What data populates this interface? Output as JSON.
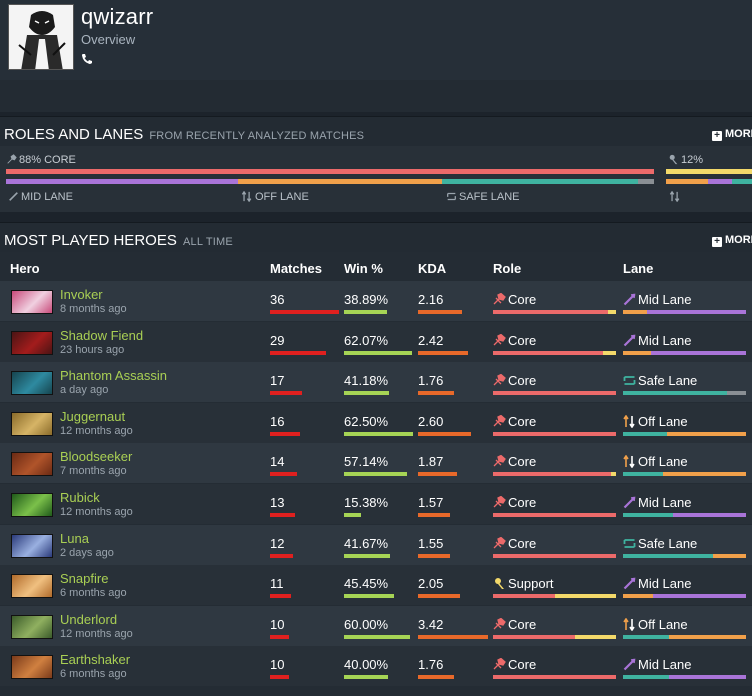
{
  "profile": {
    "name": "qwizarr",
    "subtitle": "Overview"
  },
  "roles_section": {
    "title": "ROLES AND LANES",
    "subtitle": "FROM RECENTLY ANALYZED MATCHES",
    "more": "MORE",
    "core_label": "88% CORE",
    "other_label": "12%",
    "lanes": [
      "MID LANE",
      "OFF LANE",
      "SAFE LANE"
    ],
    "colors": {
      "core": "#ec6a6a",
      "support": "#f3d96a",
      "mid": "#a974d8",
      "off": "#f1a04a",
      "safe": "#3fb3a0",
      "gray": "#8a8f94"
    }
  },
  "heroes_section": {
    "title": "MOST PLAYED HEROES",
    "subtitle": "ALL TIME",
    "more": "MORE",
    "columns": [
      "Hero",
      "Matches",
      "Win %",
      "KDA",
      "Role",
      "Lane"
    ]
  },
  "heroes": [
    {
      "name": "Invoker",
      "time": "8 months ago",
      "matches": "36",
      "win": "38.89%",
      "kda": "2.16",
      "role": "Core",
      "lane": "Mid Lane",
      "matches_frac": 1.0,
      "win_frac": 0.3889,
      "kda_frac": 0.63,
      "role_icon": "core-icon",
      "lane_icon": "mid-lane-icon"
    },
    {
      "name": "Shadow Fiend",
      "time": "23 hours ago",
      "matches": "29",
      "win": "62.07%",
      "kda": "2.42",
      "role": "Core",
      "lane": "Mid Lane",
      "matches_frac": 0.81,
      "win_frac": 0.6207,
      "kda_frac": 0.71,
      "role_icon": "core-icon",
      "lane_icon": "mid-lane-icon"
    },
    {
      "name": "Phantom Assassin",
      "time": "a day ago",
      "matches": "17",
      "win": "41.18%",
      "kda": "1.76",
      "role": "Core",
      "lane": "Safe Lane",
      "matches_frac": 0.47,
      "win_frac": 0.4118,
      "kda_frac": 0.51,
      "role_icon": "core-icon",
      "lane_icon": "safe-lane-icon"
    },
    {
      "name": "Juggernaut",
      "time": "12 months ago",
      "matches": "16",
      "win": "62.50%",
      "kda": "2.60",
      "role": "Core",
      "lane": "Off Lane",
      "matches_frac": 0.44,
      "win_frac": 0.625,
      "kda_frac": 0.76,
      "role_icon": "core-icon",
      "lane_icon": "off-lane-icon"
    },
    {
      "name": "Bloodseeker",
      "time": "7 months ago",
      "matches": "14",
      "win": "57.14%",
      "kda": "1.87",
      "role": "Core",
      "lane": "Off Lane",
      "matches_frac": 0.39,
      "win_frac": 0.5714,
      "kda_frac": 0.55,
      "role_icon": "core-icon",
      "lane_icon": "off-lane-icon"
    },
    {
      "name": "Rubick",
      "time": "12 months ago",
      "matches": "13",
      "win": "15.38%",
      "kda": "1.57",
      "role": "Core",
      "lane": "Mid Lane",
      "matches_frac": 0.36,
      "win_frac": 0.1538,
      "kda_frac": 0.46,
      "role_icon": "core-icon",
      "lane_icon": "mid-lane-icon"
    },
    {
      "name": "Luna",
      "time": "2 days ago",
      "matches": "12",
      "win": "41.67%",
      "kda": "1.55",
      "role": "Core",
      "lane": "Safe Lane",
      "matches_frac": 0.33,
      "win_frac": 0.4167,
      "kda_frac": 0.45,
      "role_icon": "core-icon",
      "lane_icon": "safe-lane-icon"
    },
    {
      "name": "Snapfire",
      "time": "6 months ago",
      "matches": "11",
      "win": "45.45%",
      "kda": "2.05",
      "role": "Support",
      "lane": "Mid Lane",
      "matches_frac": 0.31,
      "win_frac": 0.4545,
      "kda_frac": 0.6,
      "role_icon": "support-icon",
      "lane_icon": "mid-lane-icon"
    },
    {
      "name": "Underlord",
      "time": "12 months ago",
      "matches": "10",
      "win": "60.00%",
      "kda": "3.42",
      "role": "Core",
      "lane": "Off Lane",
      "matches_frac": 0.28,
      "win_frac": 0.6,
      "kda_frac": 1.0,
      "role_icon": "core-icon",
      "lane_icon": "off-lane-icon"
    },
    {
      "name": "Earthshaker",
      "time": "6 months ago",
      "matches": "10",
      "win": "40.00%",
      "kda": "1.76",
      "role": "Core",
      "lane": "Mid Lane",
      "matches_frac": 0.28,
      "win_frac": 0.4,
      "kda_frac": 0.51,
      "role_icon": "core-icon",
      "lane_icon": "mid-lane-icon"
    }
  ]
}
